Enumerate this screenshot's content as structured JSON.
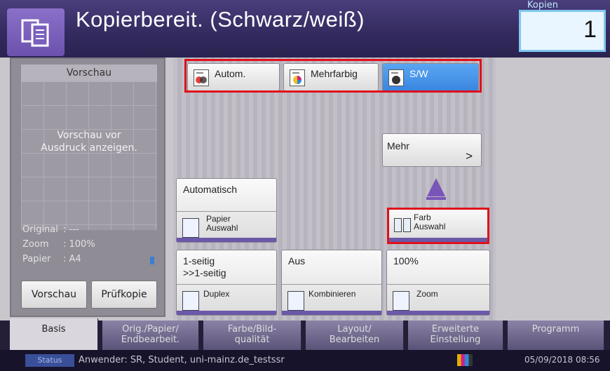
{
  "header": {
    "title": "Kopierbereit. (Schwarz/weiß)",
    "copies_label": "Kopien",
    "copies_value": "1"
  },
  "preview": {
    "title": "Vorschau",
    "message_line1": "Vorschau vor",
    "message_line2": "Ausdruck anzeigen.",
    "info": [
      {
        "key": "Original",
        "value": ": ---"
      },
      {
        "key": "Zoom",
        "value": ": 100%"
      },
      {
        "key": "Papier",
        "value": ": A4"
      }
    ],
    "preview_button": "Vorschau",
    "proof_button": "Prüfkopie"
  },
  "color_modes": {
    "auto": "Autom.",
    "multicolor": "Mehrfarbig",
    "bw": "S/W",
    "selected": "S/W"
  },
  "more_button": "Mehr",
  "more_arrow": ">",
  "paper": {
    "value": "Automatisch",
    "label_line1": "Papier",
    "label_line2": "Auswahl"
  },
  "color_select": {
    "label_line1": "Farb",
    "label_line2": "Auswahl"
  },
  "duplex": {
    "value_line1": "1-seitig",
    "value_line2": ">>1-seitig",
    "label": "Duplex"
  },
  "combine": {
    "value": "Aus",
    "label": "Kombinieren"
  },
  "zoom": {
    "value": "100%",
    "label": "Zoom"
  },
  "tabs": [
    {
      "line1": "Basis",
      "line2": ""
    },
    {
      "line1": "Orig./Papier/",
      "line2": "Endbearbeit."
    },
    {
      "line1": "Farbe/Bild-",
      "line2": "qualität"
    },
    {
      "line1": "Layout/",
      "line2": "Bearbeiten"
    },
    {
      "line1": "Erweiterte",
      "line2": "Einstellung"
    },
    {
      "line1": "Programm",
      "line2": ""
    }
  ],
  "status": {
    "button": "Status",
    "user": "Anwender: SR, Student, uni-mainz.de_testssr",
    "datetime": "05/09/2018 08:56"
  },
  "colors": {
    "highlight": "#e0101a",
    "accent_purple": "#6b58a8",
    "selected_blue": "#3f8fe8"
  }
}
